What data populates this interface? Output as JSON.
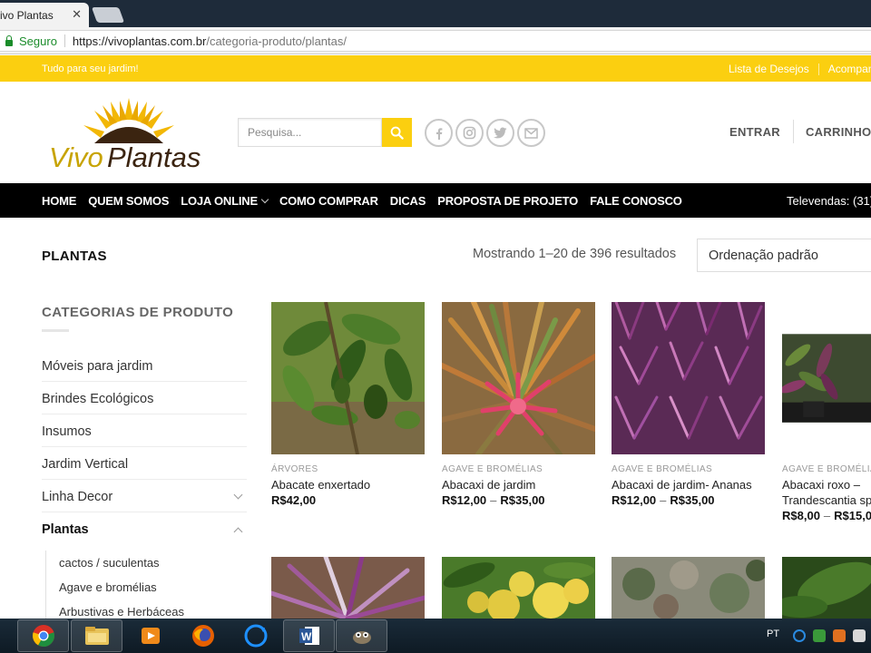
{
  "browser": {
    "tab_title": "ivo Plantas",
    "secure_label": "Seguro",
    "url_host": "https://vivoplantas.com.br",
    "url_path": "/categoria-produto/plantas/"
  },
  "topbar": {
    "tagline": "Tudo para seu jardim!",
    "links": [
      "Lista de Desejos",
      "Acompan"
    ]
  },
  "logo": {
    "text": "VivoPlantas"
  },
  "search": {
    "placeholder": "Pesquisa..."
  },
  "socials": [
    "facebook-icon",
    "instagram-icon",
    "twitter-icon",
    "email-icon"
  ],
  "header_nav": {
    "login": "ENTRAR",
    "cart": "CARRINHO / R"
  },
  "main_nav": {
    "items": [
      "HOME",
      "QUEM SOMOS",
      "LOJA ONLINE",
      "COMO COMPRAR",
      "DICAS",
      "PROPOSTA DE PROJETO",
      "FALE CONOSCO"
    ],
    "phone": "Televendas: (31)"
  },
  "page": {
    "title": "PLANTAS",
    "result_count": "Mostrando 1–20 de 396 resultados",
    "orderby": "Ordenação padrão"
  },
  "sidebar": {
    "title": "CATEGORIAS DE PRODUTO",
    "categories": [
      "Móveis para jardim",
      "Brindes Ecológicos",
      "Insumos",
      "Jardim Vertical",
      "Linha Decor",
      "Plantas"
    ],
    "subcategories": [
      "cactos / suculentas",
      "Agave e bromélias",
      "Arbustivas e Herbáceas"
    ]
  },
  "products": [
    {
      "category": "ÁRVORES",
      "name": "Abacate enxertado",
      "price": "R$42,00",
      "price_max": ""
    },
    {
      "category": "AGAVE E BROMÉLIAS",
      "name": "Abacaxi de jardim",
      "price": "R$12,00",
      "price_max": "R$35,00"
    },
    {
      "category": "AGAVE E BROMÉLIAS",
      "name": "Abacaxi de jardim- Ananas",
      "price": "R$12,00",
      "price_max": "R$35,00"
    },
    {
      "category": "AGAVE E BROMÉLIA",
      "name": "Abacaxi roxo –",
      "name2": "Trandescantia sp",
      "price": "R$8,00",
      "price_max": "R$15,0"
    }
  ],
  "taskbar": {
    "lang": "PT"
  },
  "colors": {
    "accent": "#fbcf10",
    "nav_bg": "#000000",
    "secure": "#1a8c2a"
  }
}
